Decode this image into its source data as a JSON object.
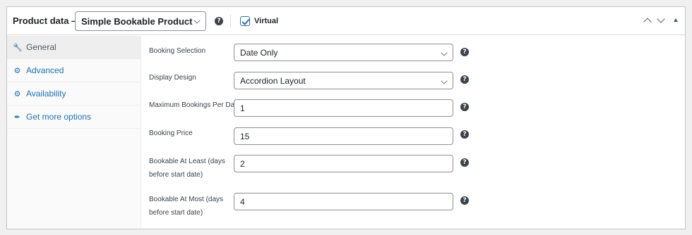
{
  "header": {
    "title": "Product data —",
    "product_type": "Simple Bookable Product",
    "virtual_label": "Virtual",
    "virtual_checked": true,
    "help_glyph": "?"
  },
  "tabs": [
    {
      "label": "General",
      "icon": "wrench-icon",
      "glyph": "🔧",
      "active": true
    },
    {
      "label": "Advanced",
      "icon": "gear-icon",
      "glyph": "⚙",
      "active": false
    },
    {
      "label": "Availability",
      "icon": "gear-icon",
      "glyph": "⚙",
      "active": false
    },
    {
      "label": "Get more options",
      "icon": "plugin-icon",
      "glyph": "✒",
      "active": false
    }
  ],
  "fields": [
    {
      "label": "Booking Selection",
      "value": "Date Only",
      "type": "select"
    },
    {
      "label": "Display Design",
      "value": "Accordion Layout",
      "type": "select"
    },
    {
      "label": "Maximum Bookings Per Day",
      "value": "1",
      "type": "input"
    },
    {
      "label": "Booking Price",
      "value": "15",
      "type": "input"
    },
    {
      "label_line1": "Bookable At Least (days",
      "label_line2": "before start date)",
      "value": "2",
      "type": "input"
    },
    {
      "label_line1": "Bookable At Most (days",
      "label_line2": "before start date)",
      "value": "4",
      "type": "input"
    }
  ]
}
